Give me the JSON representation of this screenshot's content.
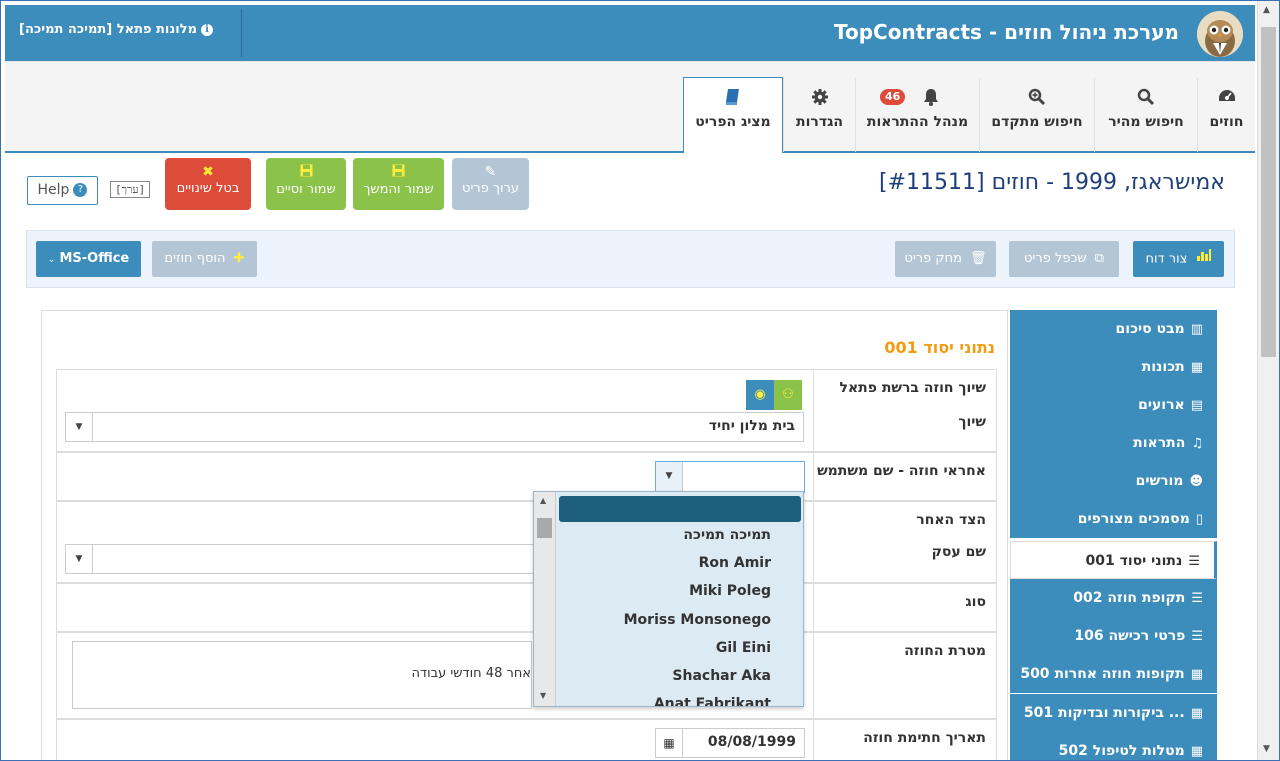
{
  "header": {
    "app_title": "TopContracts - מערכת ניהול חוזים",
    "user_line": "מלונות פתאל [תמיכה תמיכה]"
  },
  "nav_tabs": [
    {
      "label": "חוזים",
      "icon": "dashboard-icon"
    },
    {
      "label": "חיפוש מהיר",
      "icon": "search-icon"
    },
    {
      "label": "חיפוש מתקדם",
      "icon": "zoom-in-icon"
    },
    {
      "label": "מנהל ההתראות",
      "icon": "bell-icon",
      "badge": "46"
    },
    {
      "label": "הגדרות",
      "icon": "gear-icon"
    },
    {
      "label": "מציג הפריט",
      "icon": "book-icon",
      "active": true
    }
  ],
  "page": {
    "title": "[#11511] אמישראגז, 1999 - חוזים",
    "edit_tag": "[ערך]",
    "help_label": "Help"
  },
  "actions": {
    "edit": "ערוך פריט",
    "save_continue": "שמור והמשך",
    "save_finish": "שמור וסיים",
    "cancel": "בטל שינויים"
  },
  "toolbar": {
    "report": "צור דוח",
    "duplicate": "שכפל פריט",
    "delete": "מחק פריט",
    "add_contracts": "הוסף חוזים",
    "ms_office": "MS-Office"
  },
  "section": {
    "title": "001 נתוני יסוד"
  },
  "form": {
    "assign_label": "שיוך חוזה ברשת פתאל",
    "assign_sub_label": "שיוך",
    "assign_value": "בית מלון יחיד",
    "owner_label": "אחראי חוזה - שם משתמש",
    "other_party_label": "הצד האחר",
    "business_name_label": "שם עסק",
    "type_label": "סוג",
    "purpose_label": "מטרת החוזה",
    "purpose_value": "אחר 48 חודשי עבודה",
    "sign_date_label": "תאריך חתימת חוזה",
    "sign_date_value": "08/08/1999"
  },
  "dropdown": {
    "options": [
      "תמיכה תמיכה",
      "Ron Amir",
      "Miki Poleg",
      "Moriss Monsonego",
      "Gil Eini",
      "Shachar Aka",
      "Anat Fabrikant"
    ]
  },
  "sidebar": {
    "items": [
      {
        "label": "מבט סיכום",
        "icon": "barcode-icon"
      },
      {
        "label": "תכונות",
        "icon": "grid-icon"
      },
      {
        "label": "ארועים",
        "icon": "calendar-icon"
      },
      {
        "label": "התראות",
        "icon": "bell-icon"
      },
      {
        "label": "מורשים",
        "icon": "users-icon"
      },
      {
        "label": "מסמכים מצורפים",
        "icon": "document-icon"
      },
      {
        "label": "001 נתוני יסוד",
        "icon": "list-icon",
        "active": true
      },
      {
        "label": "002 תקופת חוזה",
        "icon": "list-icon"
      },
      {
        "label": "106 פרטי רכישה",
        "icon": "list-icon"
      },
      {
        "label": "500 תקופות חוזה אחרות",
        "icon": "table-icon"
      },
      {
        "label": "501 ביקורות ובדיקות ...",
        "icon": "table-icon"
      },
      {
        "label": "502 מטלות לטיפול",
        "icon": "table-icon"
      }
    ]
  }
}
